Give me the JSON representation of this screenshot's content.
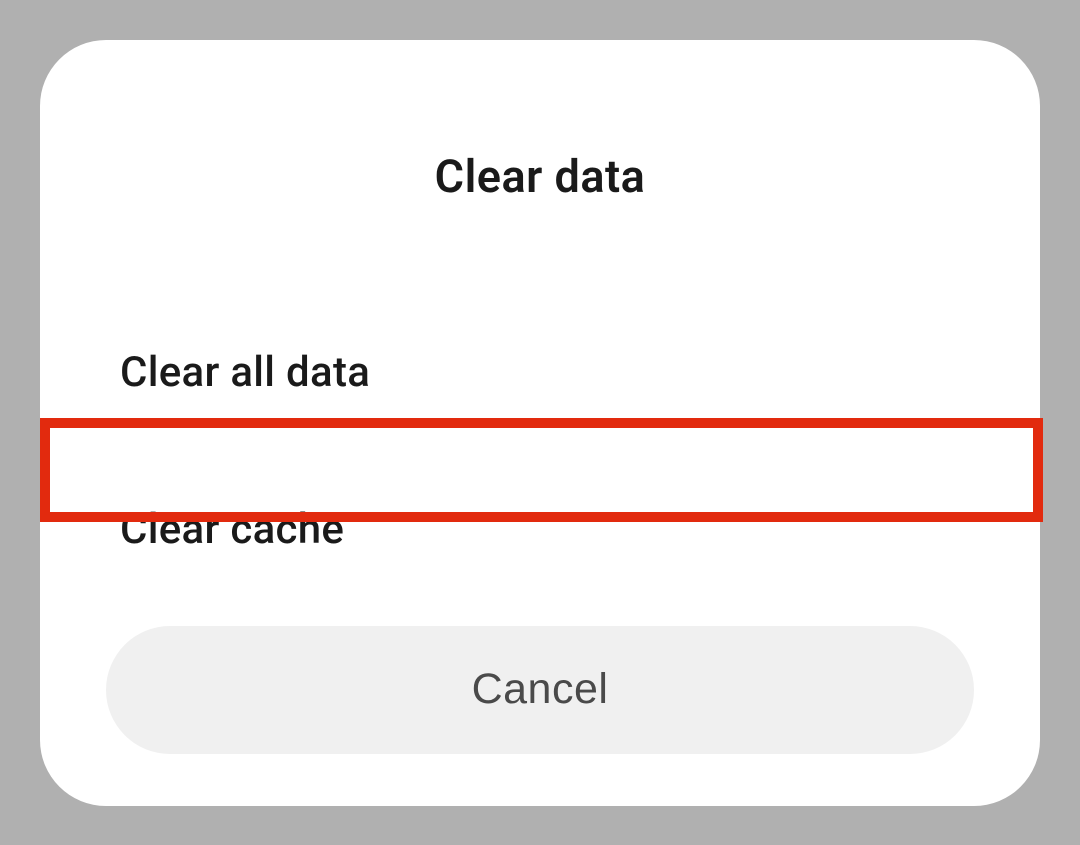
{
  "dialog": {
    "title": "Clear data",
    "options": {
      "clear_all_data": "Clear all data",
      "clear_cache": "Clear cache"
    },
    "cancel_label": "Cancel"
  },
  "colors": {
    "highlight": "#e22a0e",
    "background": "#b0b0b0",
    "dialog_bg": "#ffffff",
    "button_bg": "#f0f0f0"
  }
}
